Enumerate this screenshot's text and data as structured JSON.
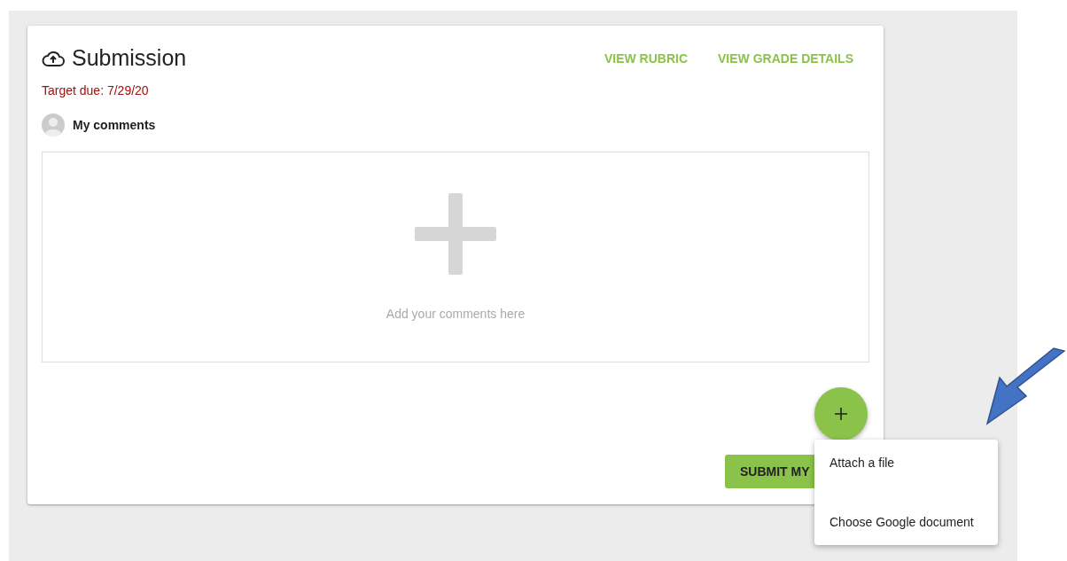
{
  "submission": {
    "title": "Submission",
    "links": [
      "VIEW RUBRIC",
      "VIEW GRADE DETAILS"
    ],
    "due": "Target due: 7/29/20",
    "comments_label": "My comments",
    "comment_box": {
      "placeholder": "Add your comments here"
    },
    "submit_button": "SUBMIT MY"
  },
  "menu": {
    "items": [
      "Attach a file",
      "Choose Google document"
    ]
  }
}
